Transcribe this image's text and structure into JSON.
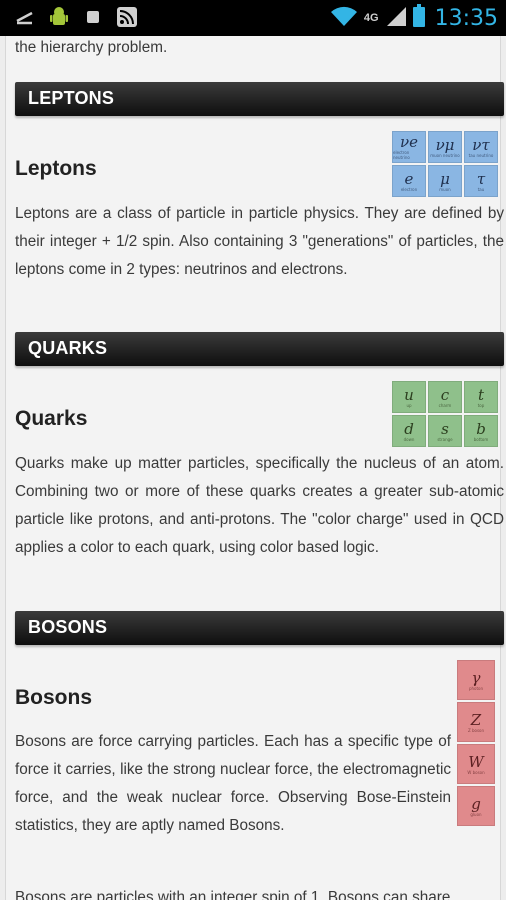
{
  "status_bar": {
    "network": "4G",
    "time": "13:35",
    "icons": [
      "usb-debug-icon",
      "android-icon",
      "stop-icon",
      "rss-icon",
      "wifi-icon",
      "signal-icon",
      "battery-icon"
    ]
  },
  "intro": {
    "tail": "the hierarchy problem."
  },
  "sections": {
    "leptons": {
      "banner": "LEPTONS",
      "heading": "Leptons",
      "body": "Leptons are a class of particle in particle physics. They are defined by their integer + 1/2 spin. Also containing 3 \"generations\" of particles, the leptons come in 2 types: neutrinos and electrons.",
      "cells": [
        {
          "sym": "νe",
          "sub": "electron neutrino"
        },
        {
          "sym": "νμ",
          "sub": "muon neutrino"
        },
        {
          "sym": "ντ",
          "sub": "tau neutrino"
        },
        {
          "sym": "e",
          "sub": "electron"
        },
        {
          "sym": "μ",
          "sub": "muon"
        },
        {
          "sym": "τ",
          "sub": "tau"
        }
      ]
    },
    "quarks": {
      "banner": "QUARKS",
      "heading": "Quarks",
      "body": "Quarks make up matter particles, specifically the nucleus of an atom. Combining two or more of these quarks creates a greater sub-atomic particle like protons, and anti-protons. The \"color charge\" used in QCD applies a color to each quark, using color based logic.",
      "cells": [
        {
          "sym": "u",
          "sub": "up"
        },
        {
          "sym": "c",
          "sub": "charm"
        },
        {
          "sym": "t",
          "sub": "top"
        },
        {
          "sym": "d",
          "sub": "down"
        },
        {
          "sym": "s",
          "sub": "strange"
        },
        {
          "sym": "b",
          "sub": "bottom"
        }
      ]
    },
    "bosons": {
      "banner": "BOSONS",
      "heading": "Bosons",
      "body": "Bosons are force carrying particles. Each has a specific type of force it carries, like the strong nuclear force, the electromagnetic force, and the weak nuclear force. Observing Bose-Einstein statistics, they are aptly named Bosons.",
      "cells": [
        {
          "sym": "γ",
          "sub": "photon"
        },
        {
          "sym": "Z",
          "sub": "Z boson"
        },
        {
          "sym": "W",
          "sub": "W boson"
        },
        {
          "sym": "g",
          "sub": "gluon"
        }
      ]
    }
  },
  "footer_partial": "Bosons are particles with an integer spin of 1. Bosons can share"
}
